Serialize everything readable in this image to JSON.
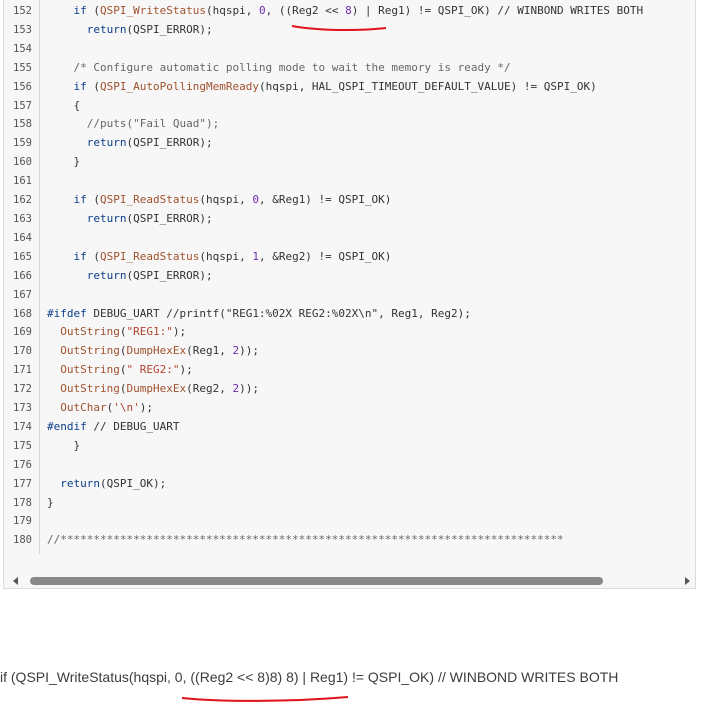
{
  "code_lines": [
    {
      "n": "152",
      "segs": [
        [
          "    ",
          "t"
        ],
        [
          "if",
          "kw"
        ],
        [
          " (",
          "t"
        ],
        [
          "QSPI_WriteStatus",
          "fn"
        ],
        [
          "(hqspi, ",
          "t"
        ],
        [
          "0",
          "num"
        ],
        [
          ", ((Reg2 << ",
          "t"
        ],
        [
          "8",
          "num"
        ],
        [
          ") | Reg1) != QSPI_OK) // WINBOND WRITES BOTH",
          "t"
        ]
      ]
    },
    {
      "n": "153",
      "segs": [
        [
          "      ",
          "t"
        ],
        [
          "return",
          "kw"
        ],
        [
          "(QSPI_ERROR);",
          "t"
        ]
      ]
    },
    {
      "n": "154",
      "segs": []
    },
    {
      "n": "155",
      "segs": [
        [
          "    ",
          "t"
        ],
        [
          "/* Configure automatic polling mode to wait the memory is ready */",
          "cm"
        ]
      ]
    },
    {
      "n": "156",
      "segs": [
        [
          "    ",
          "t"
        ],
        [
          "if",
          "kw"
        ],
        [
          " (",
          "t"
        ],
        [
          "QSPI_AutoPollingMemReady",
          "fn"
        ],
        [
          "(hqspi, HAL_QSPI_TIMEOUT_DEFAULT_VALUE) != QSPI_OK)",
          "t"
        ]
      ]
    },
    {
      "n": "157",
      "segs": [
        [
          "    {",
          "t"
        ]
      ]
    },
    {
      "n": "158",
      "segs": [
        [
          "      //puts(\"Fail Quad\");",
          "cm"
        ]
      ]
    },
    {
      "n": "159",
      "segs": [
        [
          "      ",
          "t"
        ],
        [
          "return",
          "kw"
        ],
        [
          "(QSPI_ERROR);",
          "t"
        ]
      ]
    },
    {
      "n": "160",
      "segs": [
        [
          "    }",
          "t"
        ]
      ]
    },
    {
      "n": "161",
      "segs": []
    },
    {
      "n": "162",
      "segs": [
        [
          "    ",
          "t"
        ],
        [
          "if",
          "kw"
        ],
        [
          " (",
          "t"
        ],
        [
          "QSPI_ReadStatus",
          "fn"
        ],
        [
          "(hqspi, ",
          "t"
        ],
        [
          "0",
          "num"
        ],
        [
          ", &Reg1) != QSPI_OK)",
          "t"
        ]
      ]
    },
    {
      "n": "163",
      "segs": [
        [
          "      ",
          "t"
        ],
        [
          "return",
          "kw"
        ],
        [
          "(QSPI_ERROR);",
          "t"
        ]
      ]
    },
    {
      "n": "164",
      "segs": []
    },
    {
      "n": "165",
      "segs": [
        [
          "    ",
          "t"
        ],
        [
          "if",
          "kw"
        ],
        [
          " (",
          "t"
        ],
        [
          "QSPI_ReadStatus",
          "fn"
        ],
        [
          "(hqspi, ",
          "t"
        ],
        [
          "1",
          "num"
        ],
        [
          ", &Reg2) != QSPI_OK)",
          "t"
        ]
      ]
    },
    {
      "n": "166",
      "segs": [
        [
          "      ",
          "t"
        ],
        [
          "return",
          "kw"
        ],
        [
          "(QSPI_ERROR);",
          "t"
        ]
      ]
    },
    {
      "n": "167",
      "segs": []
    },
    {
      "n": "168",
      "segs": [
        [
          "#ifdef",
          "pp"
        ],
        [
          " DEBUG_UART //printf(\"REG1:%02X REG2:%02X\\n\", Reg1, Reg2);",
          "t"
        ]
      ]
    },
    {
      "n": "169",
      "segs": [
        [
          "  ",
          "t"
        ],
        [
          "OutString",
          "fn"
        ],
        [
          "(",
          "t"
        ],
        [
          "\"REG1:\"",
          "str"
        ],
        [
          ");",
          "t"
        ]
      ]
    },
    {
      "n": "170",
      "segs": [
        [
          "  ",
          "t"
        ],
        [
          "OutString",
          "fn"
        ],
        [
          "(",
          "t"
        ],
        [
          "DumpHexEx",
          "fn"
        ],
        [
          "(Reg1, ",
          "t"
        ],
        [
          "2",
          "num"
        ],
        [
          "));",
          "t"
        ]
      ]
    },
    {
      "n": "171",
      "segs": [
        [
          "  ",
          "t"
        ],
        [
          "OutString",
          "fn"
        ],
        [
          "(",
          "t"
        ],
        [
          "\" REG2:\"",
          "str"
        ],
        [
          ");",
          "t"
        ]
      ]
    },
    {
      "n": "172",
      "segs": [
        [
          "  ",
          "t"
        ],
        [
          "OutString",
          "fn"
        ],
        [
          "(",
          "t"
        ],
        [
          "DumpHexEx",
          "fn"
        ],
        [
          "(Reg2, ",
          "t"
        ],
        [
          "2",
          "num"
        ],
        [
          "));",
          "t"
        ]
      ]
    },
    {
      "n": "173",
      "segs": [
        [
          "  ",
          "t"
        ],
        [
          "OutChar",
          "fn"
        ],
        [
          "(",
          "t"
        ],
        [
          "'\\n'",
          "str"
        ],
        [
          ");",
          "t"
        ]
      ]
    },
    {
      "n": "174",
      "segs": [
        [
          "#endif",
          "pp"
        ],
        [
          " // DEBUG_UART",
          "t"
        ]
      ]
    },
    {
      "n": "175",
      "segs": [
        [
          "    }",
          "t"
        ]
      ]
    },
    {
      "n": "176",
      "segs": []
    },
    {
      "n": "177",
      "segs": [
        [
          "  ",
          "t"
        ],
        [
          "return",
          "kw"
        ],
        [
          "(QSPI_OK);",
          "t"
        ]
      ]
    },
    {
      "n": "178",
      "segs": [
        [
          "}",
          "t"
        ]
      ]
    },
    {
      "n": "179",
      "segs": []
    },
    {
      "n": "180",
      "segs": [
        [
          "//****************************************************************************",
          "cm"
        ]
      ]
    }
  ],
  "bottom_text": "if (QSPI_WriteStatus(hqspi, 0, ((Reg2 << 8)8) 8) | Reg1) != QSPI_OK) // WINBOND WRITES BOTH",
  "colors": {
    "underline": "#e0121b",
    "scroll_thumb": "#888888"
  }
}
